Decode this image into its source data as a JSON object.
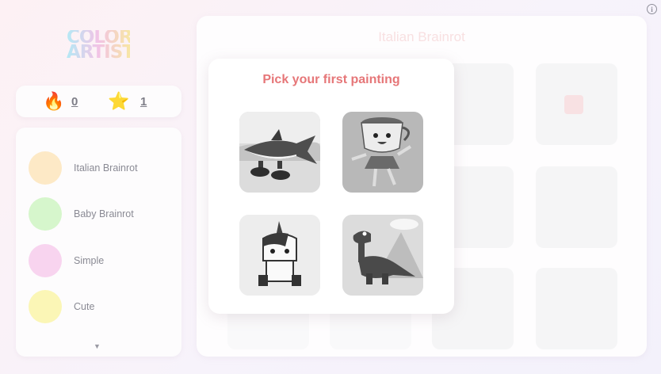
{
  "app": {
    "logo_text": "COLOR ARTIST"
  },
  "stats": {
    "fire_count": "0",
    "star_count": "1"
  },
  "categories": [
    {
      "label": "Italian Brainrot",
      "color": "#fde9c6"
    },
    {
      "label": "Baby Brainrot",
      "color": "#d6f6cc"
    },
    {
      "label": "Simple",
      "color": "#f8d4ef"
    },
    {
      "label": "Cute",
      "color": "#fbf6b6"
    }
  ],
  "main": {
    "title": "Italian Brainrot"
  },
  "modal": {
    "title": "Pick your first painting",
    "paintings": [
      {
        "icon": "shark-with-sneakers-icon"
      },
      {
        "icon": "teacup-ballerina-icon"
      },
      {
        "icon": "unicorn-icon"
      },
      {
        "icon": "dinosaur-icon"
      }
    ]
  },
  "colors": {
    "accent": "#e67678",
    "title_faded": "#f5cfd2",
    "text": "#8a8a94"
  }
}
